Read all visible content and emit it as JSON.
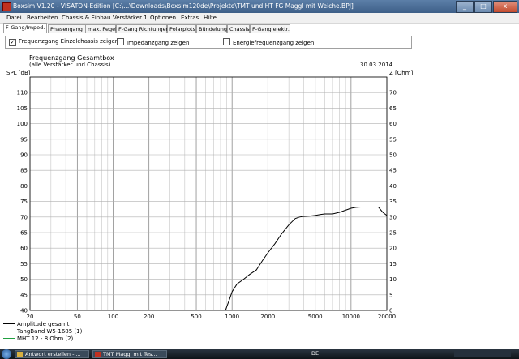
{
  "window": {
    "title": "Boxsim V1.20 - VISATON-Edition [C:\\...\\Downloads\\Boxsim120de\\Projekte\\TMT und HT FG Maggl mit Weiche.BPJ]",
    "buttons": {
      "minimize": "_",
      "maximize": "□",
      "close": "x"
    }
  },
  "menu": [
    "Datei",
    "Bearbeiten",
    "Chassis & Einbau",
    "Verstärker 1",
    "Optionen",
    "Extras",
    "Hilfe"
  ],
  "tabs": [
    "F-Gang/Imped.",
    "Phasengang",
    "max. Pegel",
    "F-Gang Richtungen",
    "Polarplots",
    "Bündelung",
    "Chassis",
    "F-Gang elektr."
  ],
  "active_tab": 0,
  "options": [
    {
      "label": "Frequenzgang Einzelchassis zeigen",
      "checked": true
    },
    {
      "label": "Impedanzgang zeigen",
      "checked": false
    },
    {
      "label": "Energiefrequenzgang zeigen",
      "checked": false
    }
  ],
  "chart_data": {
    "type": "line",
    "title": "Frequenzgang Gesamtbox",
    "subtitle": "(alle Verstärker und Chassis)",
    "date": "30.03.2014",
    "ylabel": "SPL [dB]",
    "y2label": "Z [Ohm]",
    "xscale": "log",
    "xlim": [
      20,
      20000
    ],
    "ylim": [
      40,
      115
    ],
    "y2lim": [
      0,
      75
    ],
    "grid": true,
    "x_ticks": [
      "20",
      "50",
      "100",
      "200",
      "500",
      "1000",
      "2000",
      "5000",
      "10000",
      "20000"
    ],
    "y_ticks": [
      40,
      45,
      50,
      55,
      60,
      65,
      70,
      75,
      80,
      85,
      90,
      95,
      100,
      105,
      110
    ],
    "y2_ticks": [
      0,
      5,
      10,
      15,
      20,
      25,
      30,
      35,
      40,
      45,
      50,
      55,
      60,
      65,
      70
    ],
    "series": [
      {
        "name": "Amplitude gesamt",
        "color": "#000000",
        "x": [
          880,
          950,
          1000,
          1100,
          1250,
          1400,
          1600,
          1800,
          2000,
          2300,
          2600,
          3000,
          3400,
          3700,
          4000,
          4500,
          5000,
          5500,
          6000,
          7000,
          8000,
          9000,
          10000,
          11000,
          12000,
          13000,
          15000,
          17000,
          18500,
          20000
        ],
        "y": [
          40,
          43.5,
          46,
          48.5,
          50,
          51.5,
          53,
          56,
          58.5,
          61.5,
          64.5,
          67.5,
          69.5,
          70,
          70.2,
          70.3,
          70.5,
          70.8,
          71,
          71,
          71.5,
          72.2,
          72.8,
          73.1,
          73.2,
          73.2,
          73.2,
          73.2,
          71.5,
          70.5
        ]
      }
    ],
    "legend": [
      {
        "name": "Amplitude gesamt",
        "color": "#000000"
      },
      {
        "name": "TangBand W5-1685 (1)",
        "color": "#2030a0"
      },
      {
        "name": "MHT 12 - 8 Ohm (2)",
        "color": "#20a040"
      }
    ]
  },
  "taskbar": {
    "tasks": [
      "Antwort erstellen - ...",
      "TMT Maggl mit Tes..."
    ],
    "lang": "DE"
  }
}
